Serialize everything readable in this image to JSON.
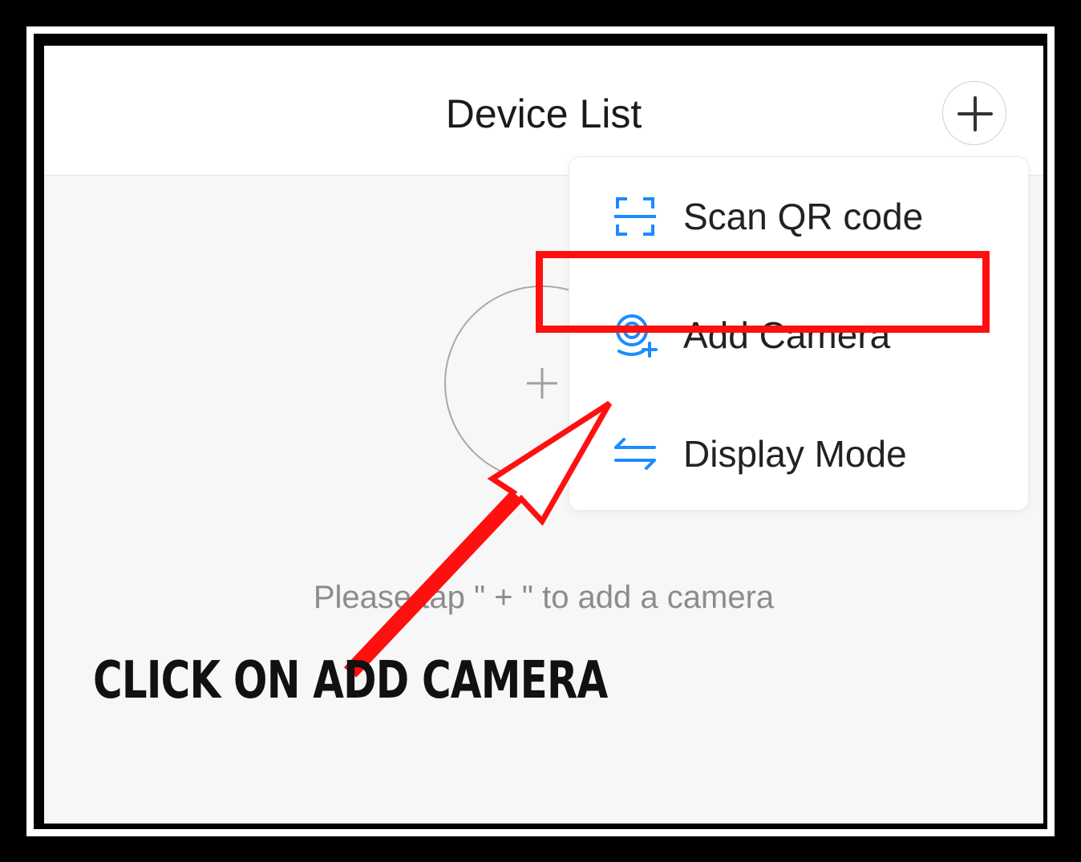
{
  "header": {
    "title": "Device List"
  },
  "menu": {
    "items": [
      {
        "label": "Scan QR code",
        "icon": "scan-qr-icon"
      },
      {
        "label": "Add Camera",
        "icon": "add-camera-icon"
      },
      {
        "label": "Display Mode",
        "icon": "swap-arrows-icon"
      }
    ]
  },
  "empty_state": {
    "hint": "Please tap \" + \" to add a camera"
  },
  "annotation": {
    "callout": "CLICK ON ADD CAMERA"
  },
  "colors": {
    "accent": "#1a8cff",
    "highlight": "#ff1010",
    "arrow": "#ff1010"
  }
}
